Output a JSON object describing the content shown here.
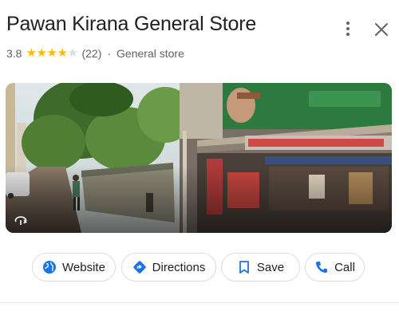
{
  "place": {
    "name": "Pawan Kirana General Store",
    "rating": "3.8",
    "stars": [
      1,
      1,
      1,
      1,
      0
    ],
    "review_count": "(22)",
    "separator": "·",
    "category": "General store"
  },
  "header_icons": [
    "more-vert-icon",
    "close-icon"
  ],
  "photo": {
    "overlay_icon": "street-view-icon"
  },
  "actions": [
    {
      "label": "Website",
      "icon": "globe-icon"
    },
    {
      "label": "Directions",
      "icon": "directions-icon"
    },
    {
      "label": "Save",
      "icon": "bookmark-icon"
    },
    {
      "label": "Call",
      "icon": "phone-icon"
    }
  ],
  "colors": {
    "accent": "#1a73e8",
    "star": "#fbbc04",
    "star_empty": "#dadce0",
    "text_secondary": "#5f6368",
    "border": "#dadce0"
  }
}
